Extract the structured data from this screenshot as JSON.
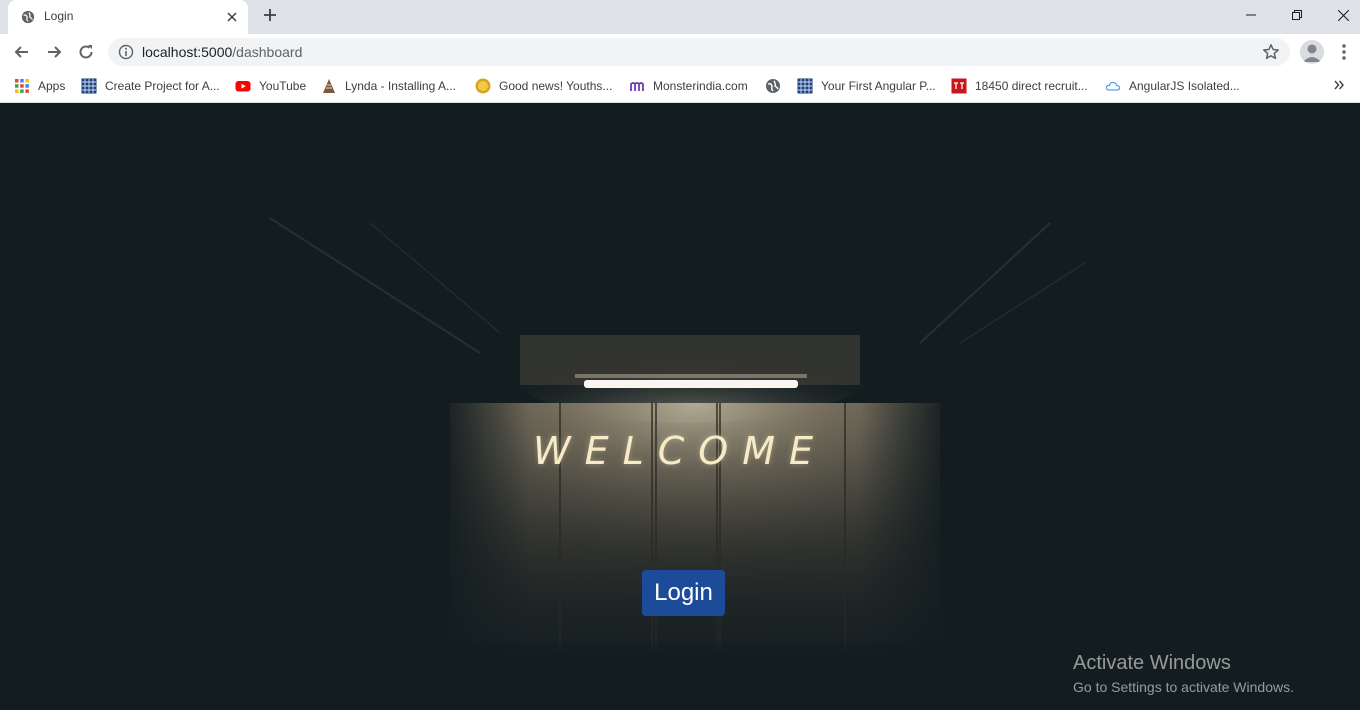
{
  "browser": {
    "tab": {
      "title": "Login",
      "favicon": "globe-icon"
    },
    "new_tab_icon": "plus-icon",
    "address": {
      "host": "localhost:5000",
      "path": "/dashboard"
    },
    "window_controls": [
      "minimize-icon",
      "restore-icon",
      "close-icon"
    ]
  },
  "bookmarks": [
    {
      "label": "Apps",
      "icon": "apps-grid-icon"
    },
    {
      "label": "Create Project for A...",
      "icon": "grid-favicon-icon"
    },
    {
      "label": "YouTube",
      "icon": "youtube-icon"
    },
    {
      "label": "Lynda - Installing A...",
      "icon": "lynda-icon"
    },
    {
      "label": "Good news! Youths...",
      "icon": "zee-icon"
    },
    {
      "label": "Monsterindia.com",
      "icon": "monster-icon"
    },
    {
      "label": "",
      "icon": "globe-icon"
    },
    {
      "label": "Your First Angular P...",
      "icon": "grid-favicon-icon"
    },
    {
      "label": "18450 direct recruit...",
      "icon": "toi-icon"
    },
    {
      "label": "AngularJS Isolated...",
      "icon": "cloud-icon"
    }
  ],
  "page": {
    "heading": "WELCOME",
    "login_button": "Login"
  },
  "watermark": {
    "title": "Activate Windows",
    "subtitle": "Go to Settings to activate Windows."
  },
  "colors": {
    "background": "#131d20",
    "heading": "#f7eac6",
    "button": "#1c4b99"
  }
}
